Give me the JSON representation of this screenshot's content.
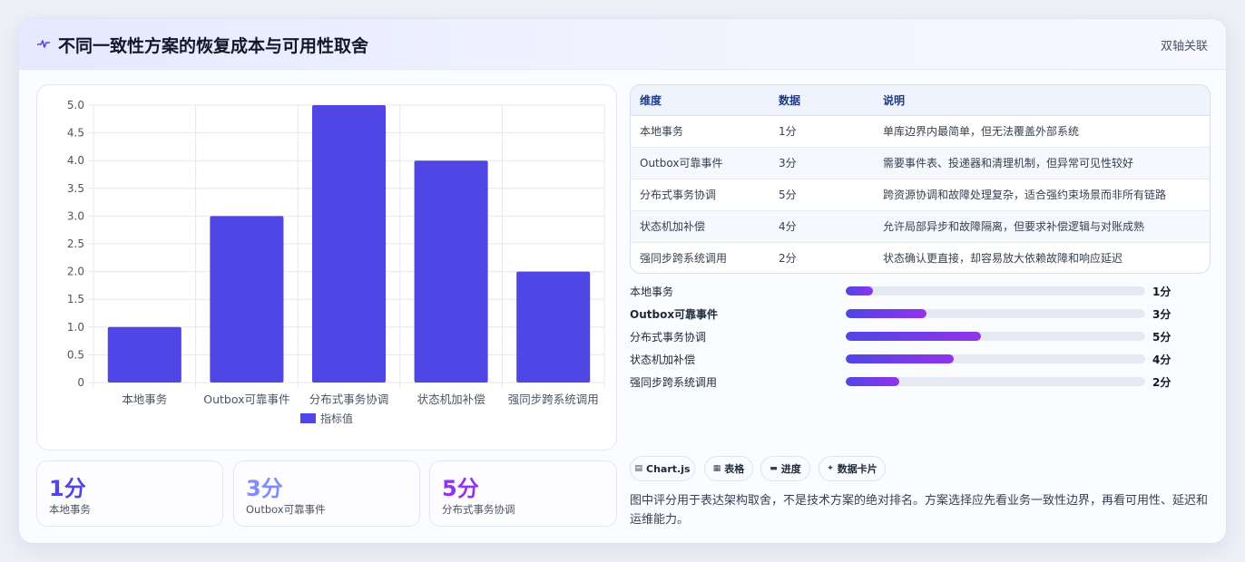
{
  "header": {
    "title": "不同一致性方案的恢复成本与可用性取舍",
    "tag": "双轴关联",
    "icon": "pulse-icon"
  },
  "chart_data": {
    "type": "bar",
    "categories": [
      "本地事务",
      "Outbox可靠事件",
      "分布式事务协调",
      "状态机加补偿",
      "强同步跨系统调用"
    ],
    "series": [
      {
        "name": "指标值",
        "values": [
          1,
          3,
          5,
          4,
          2
        ],
        "color": "#4f46e5"
      }
    ],
    "ylim": [
      0,
      5
    ],
    "yticks": [
      "0",
      "0.5",
      "1.0",
      "1.5",
      "2.0",
      "2.5",
      "3.0",
      "3.5",
      "4.0",
      "4.5",
      "5.0"
    ],
    "grid": true,
    "legend": "bottom"
  },
  "stats": [
    {
      "value": "1分",
      "label": "本地事务",
      "color": "#4f46e5"
    },
    {
      "value": "3分",
      "label": "Outbox可靠事件",
      "color": "#818cf8"
    },
    {
      "value": "5分",
      "label": "分布式事务协调",
      "color": "#9333ea"
    }
  ],
  "table": {
    "headers": [
      "维度",
      "数据",
      "说明"
    ],
    "rows": [
      [
        "本地事务",
        "1分",
        "单库边界内最简单，但无法覆盖外部系统"
      ],
      [
        "Outbox可靠事件",
        "3分",
        "需要事件表、投递器和清理机制，但异常可见性较好"
      ],
      [
        "分布式事务协调",
        "5分",
        "跨资源协调和故障处理复杂，适合强约束场景而非所有链路"
      ],
      [
        "状态机加补偿",
        "4分",
        "允许局部异步和故障隔离，但要求补偿逻辑与对账成熟"
      ],
      [
        "强同步跨系统调用",
        "2分",
        "状态确认更直接，却容易放大依赖故障和响应延迟"
      ]
    ]
  },
  "progress": [
    {
      "label": "本地事务",
      "value": "1分",
      "fraction": 0.09
    },
    {
      "label": "Outbox可靠事件",
      "value": "3分",
      "fraction": 0.27
    },
    {
      "label": "分布式事务协调",
      "value": "5分",
      "fraction": 0.45
    },
    {
      "label": "状态机加补偿",
      "value": "4分",
      "fraction": 0.36
    },
    {
      "label": "强同步跨系统调用",
      "value": "2分",
      "fraction": 0.18
    }
  ],
  "chips": [
    {
      "label": "Chart.js",
      "icon": "chart-icon"
    },
    {
      "label": "表格",
      "icon": "table-icon"
    },
    {
      "label": "进度",
      "icon": "progress-icon"
    },
    {
      "label": "数据卡片",
      "icon": "sparkle-icon"
    }
  ],
  "note": "图中评分用于表达架构取舍，不是技术方案的绝对排名。方案选择应先看业务一致性边界，再看可用性、延迟和运维能力。"
}
